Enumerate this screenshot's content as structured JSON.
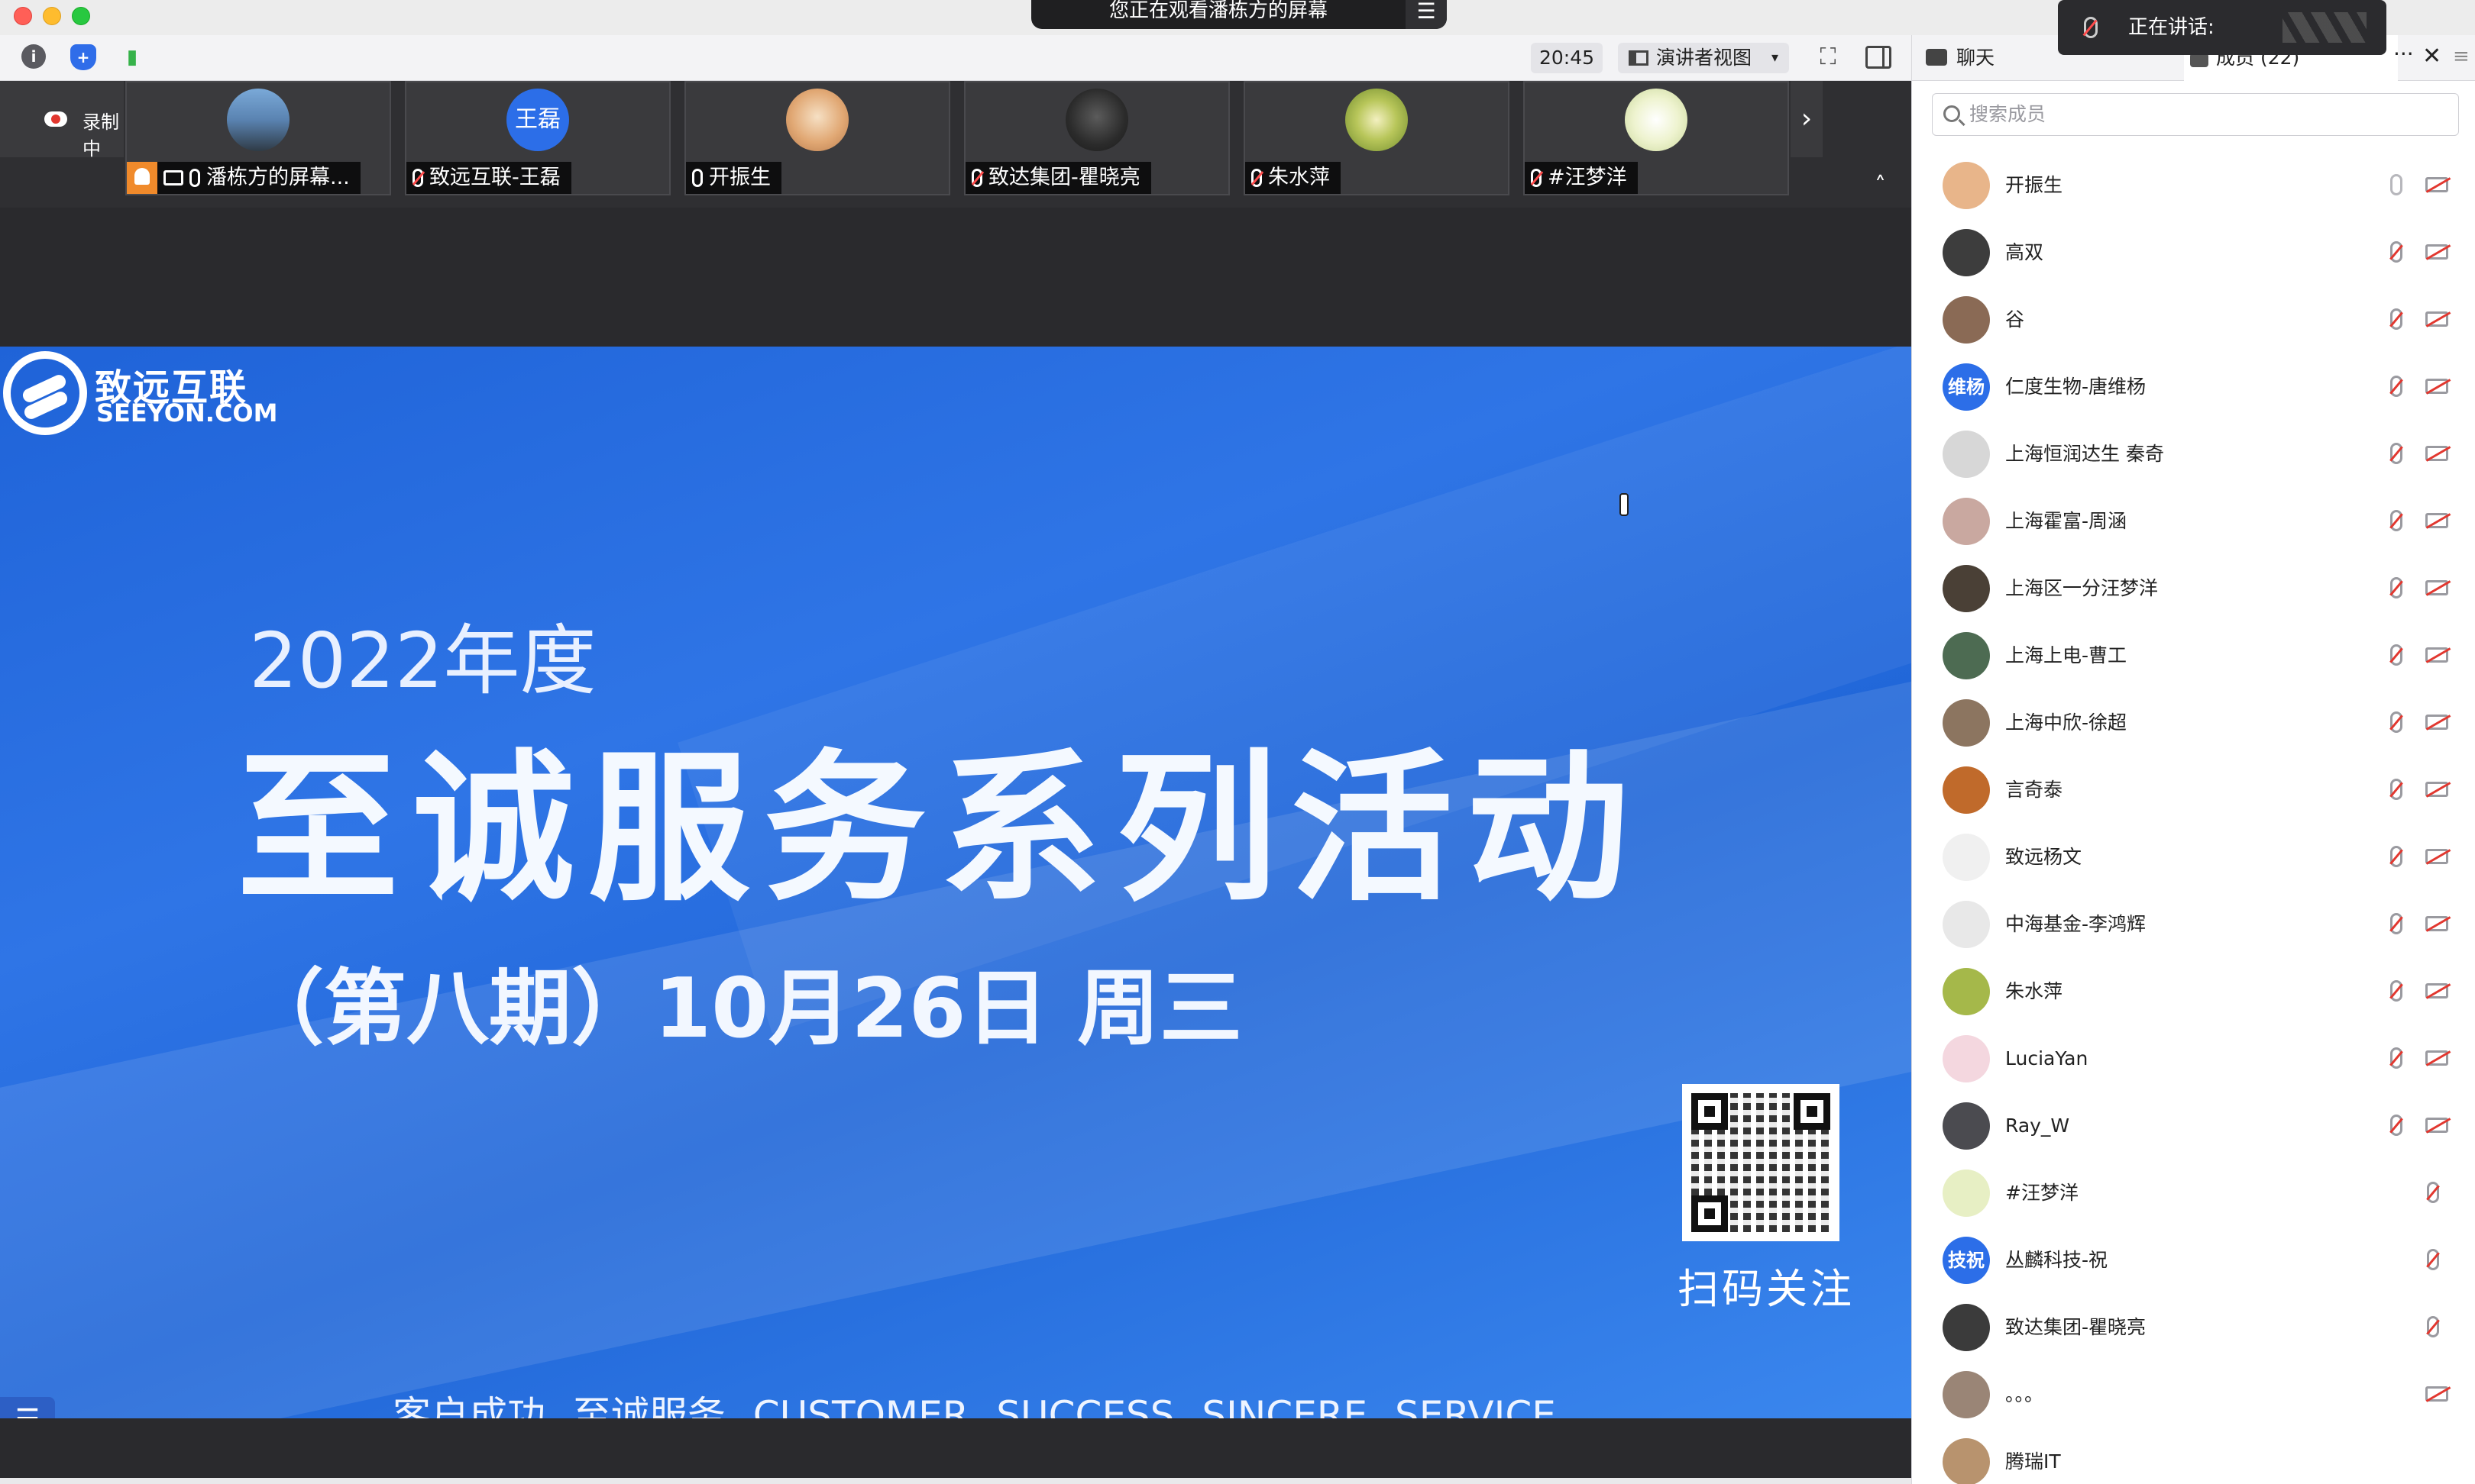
{
  "window": {
    "viewing_text": "您正在观看潘栋方的屏幕",
    "viewing_menu": "☰"
  },
  "toolbar": {
    "time": "20:45",
    "view_mode": "演讲者视图",
    "view_mode_caret": "▾",
    "fullscreen_glyph": "⛶"
  },
  "recording": {
    "label": "录制中"
  },
  "tiles": [
    {
      "name": "潘栋方的屏幕...",
      "avatar_color": "#6d9ac9"
    },
    {
      "name": "致远互联-王磊",
      "avatar_text": "王磊",
      "avatar_color": "#2c6ee8"
    },
    {
      "name": "开振生",
      "avatar_color": "#e9b98c"
    },
    {
      "name": "致达集团-瞿晓亮",
      "avatar_color": "#3b3b3b"
    },
    {
      "name": "朱水萍",
      "avatar_color": "#a5b84a"
    },
    {
      "name": "#汪梦洋",
      "avatar_color": "#e7efc4"
    }
  ],
  "strip_nav": {
    "next": "›",
    "collapse": "˄"
  },
  "slide": {
    "logo_cn": "致远互联",
    "logo_en": "SEEYON.COM",
    "year": "2022年度",
    "title": "至诚服务系列活动",
    "subtitle": "（第八期）10月26日 周三",
    "qr_caption": "扫码关注",
    "footer": "客户成功   至诚服务      CUSTOMER   SUCCESS     SINCERE   SERVICE",
    "menu_glyph": "☰"
  },
  "panel": {
    "tab_chat": "聊天",
    "tab_members": "成员 (22)",
    "more": "···",
    "close": "✕",
    "list": "≡",
    "speaking": "正在讲话:",
    "search_placeholder": "搜索成员"
  },
  "members": [
    {
      "name": "开振生",
      "avatar_color": "#e8b58a",
      "mic": "live",
      "cam": "off"
    },
    {
      "name": "高双",
      "avatar_color": "#3d3d3d",
      "mic": "muted",
      "cam": "off"
    },
    {
      "name": "谷",
      "avatar_color": "#8a6a55",
      "mic": "muted",
      "cam": "off"
    },
    {
      "name": "仁度生物-唐维杨",
      "avatar_text": "维杨",
      "avatar_color": "#2c6ee8",
      "mic": "muted",
      "cam": "off"
    },
    {
      "name": "上海恒润达生 秦奇",
      "avatar_color": "#d7d7d7",
      "mic": "muted",
      "cam": "off"
    },
    {
      "name": "上海霍富-周涵",
      "avatar_color": "#c9a8a0",
      "mic": "muted",
      "cam": "off"
    },
    {
      "name": "上海区一分汪梦洋",
      "avatar_color": "#4a4036",
      "mic": "muted",
      "cam": "off"
    },
    {
      "name": "上海上电-曹工",
      "avatar_color": "#4d6b52",
      "mic": "muted",
      "cam": "off"
    },
    {
      "name": "上海中欣-徐超",
      "avatar_color": "#8c7560",
      "mic": "muted",
      "cam": "off"
    },
    {
      "name": "言奇泰",
      "avatar_color": "#c06a2b",
      "mic": "muted",
      "cam": "off"
    },
    {
      "name": "致远杨文",
      "avatar_color": "#f0f0f0",
      "mic": "muted",
      "cam": "off"
    },
    {
      "name": "中海基金-李鸿辉",
      "avatar_color": "#e8e8e8",
      "mic": "muted",
      "cam": "off"
    },
    {
      "name": "朱水萍",
      "avatar_color": "#a5b84a",
      "mic": "muted",
      "cam": "off"
    },
    {
      "name": "LuciaYan",
      "avatar_color": "#f4d7df",
      "mic": "muted",
      "cam": "off"
    },
    {
      "name": "Ray_W",
      "avatar_color": "#4b4b50",
      "mic": "muted",
      "cam": "off"
    },
    {
      "name": "#汪梦洋",
      "avatar_color": "#e7efc4",
      "mic": "muted",
      "cam": "none"
    },
    {
      "name": "丛麟科技-祝",
      "avatar_text": "技祝",
      "avatar_color": "#2c6ee8",
      "mic": "muted",
      "cam": "none"
    },
    {
      "name": "致达集团-瞿晓亮",
      "avatar_color": "#3b3b3b",
      "mic": "muted",
      "cam": "none"
    },
    {
      "name": "。。。",
      "avatar_color": "#9a8576",
      "mic": "none",
      "cam": "off"
    },
    {
      "name": "腾瑞IT",
      "avatar_color": "#b8936e",
      "mic": "none",
      "cam": "none"
    }
  ]
}
